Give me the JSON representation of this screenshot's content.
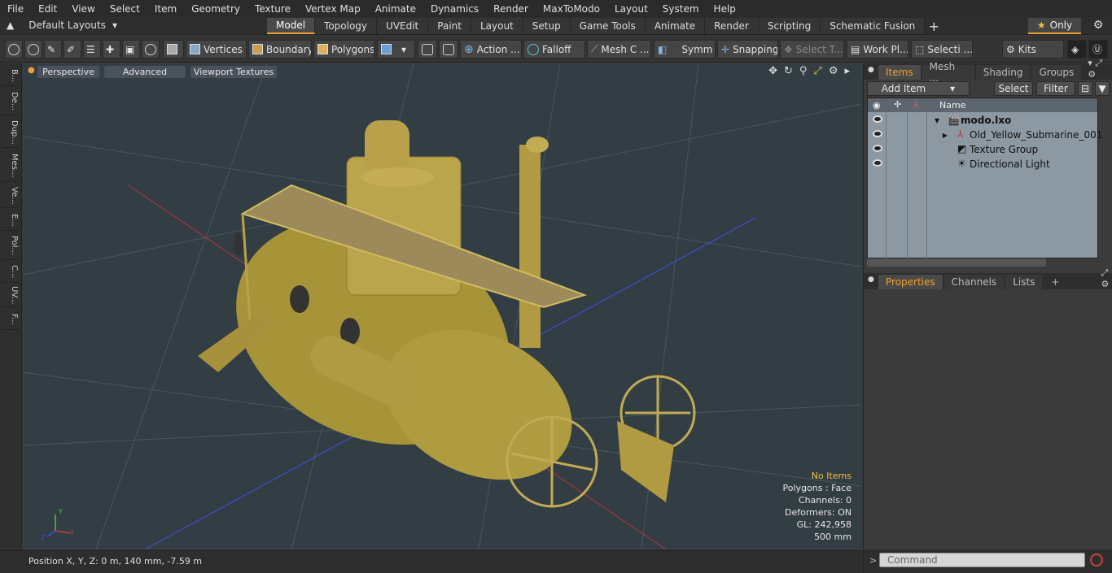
{
  "menu": [
    "File",
    "Edit",
    "View",
    "Select",
    "Item",
    "Geometry",
    "Texture",
    "Vertex Map",
    "Animate",
    "Dynamics",
    "Render",
    "MaxToModo",
    "Layout",
    "System",
    "Help"
  ],
  "layoutbar": {
    "layout_label": "Default Layouts",
    "tabs": [
      "Model",
      "Topology",
      "UVEdit",
      "Paint",
      "Layout",
      "Setup",
      "Game Tools",
      "Animate",
      "Render",
      "Scripting",
      "Schematic Fusion"
    ],
    "active_tab": "Model",
    "only_label": "Only"
  },
  "toolbar": {
    "vertices": "Vertices",
    "boundary": "Boundary",
    "polygons": "Polygons",
    "action": "Action ...",
    "falloff": "Falloff",
    "mesh": "Mesh C ...",
    "symm": "Symm ...",
    "snapping": "Snapping",
    "select_t": "Select T...",
    "work_pl": "Work Pl...",
    "selecti": "Selecti ...",
    "kits": "Kits"
  },
  "left_tabs": [
    "B...",
    "De...",
    "Dup...",
    "Mes...",
    "Ve...",
    "E...",
    "Pol...",
    "C...",
    "UV...",
    "F..."
  ],
  "viewport": {
    "perspective": "Perspective",
    "advanced": "Advanced",
    "textures": "Viewport Textures",
    "stats": {
      "items": "No Items",
      "polygons": "Polygons : Face",
      "channels": "Channels: 0",
      "deformers": "Deformers: ON",
      "gl": "GL: 242,958",
      "scale": "500 mm"
    },
    "axis": {
      "x": "X",
      "y": "Y",
      "z": "Z"
    }
  },
  "status": {
    "position": "Position X, Y, Z:   0 m, 140 mm, -7.59 m"
  },
  "items_panel": {
    "tabs": [
      "Items",
      "Mesh ...",
      "Shading",
      "Groups"
    ],
    "add_item": "Add Item",
    "select": "Select",
    "filter": "Filter",
    "col_name": "Name",
    "rows": [
      "modo.lxo",
      "Old_Yellow_Submarine_001",
      "Texture Group",
      "Directional Light"
    ]
  },
  "props_panel": {
    "tabs": [
      "Properties",
      "Channels",
      "Lists"
    ],
    "plus": "+"
  },
  "command": {
    "placeholder": "Command",
    "prompt": ">"
  },
  "colors": {
    "accent": "#f0a030",
    "viewport_bg": "#333d44",
    "submarine": "#b8a048"
  }
}
